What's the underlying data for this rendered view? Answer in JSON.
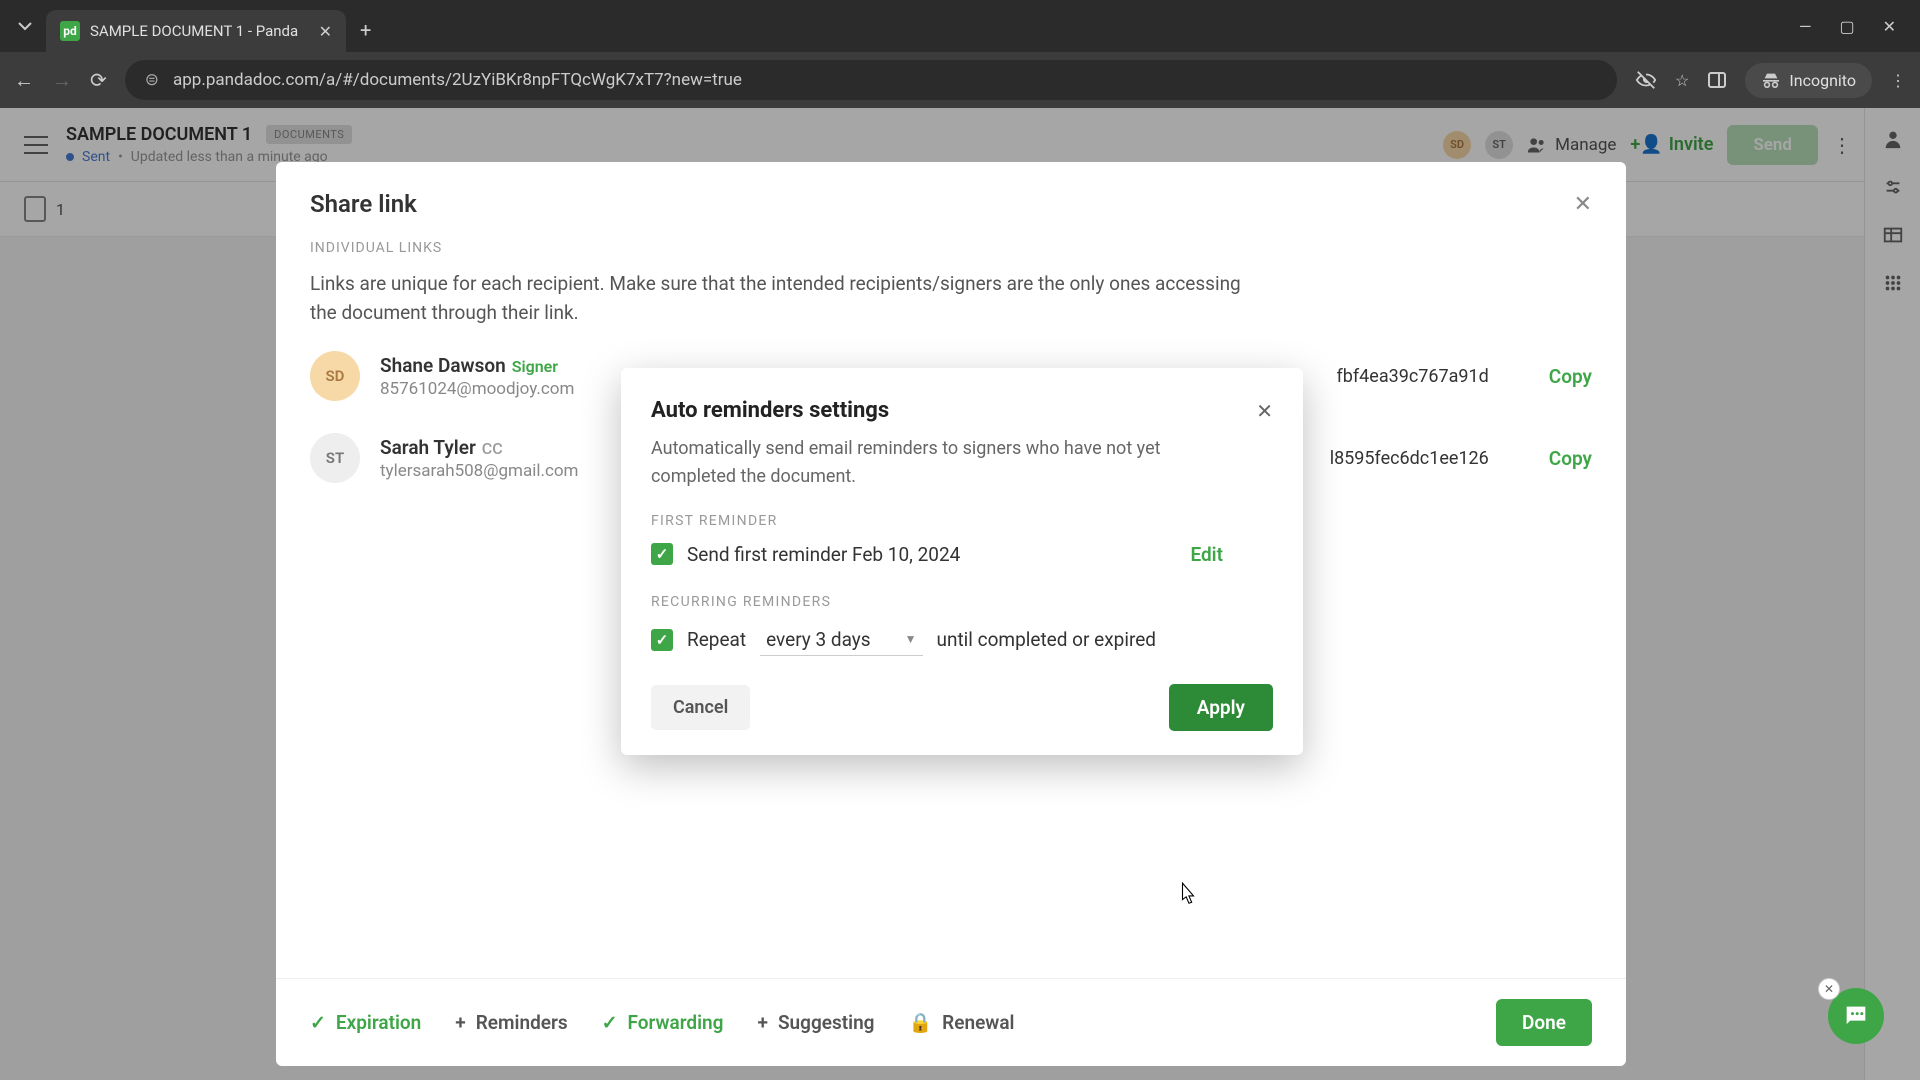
{
  "browser": {
    "tab_title": "SAMPLE DOCUMENT 1 - Panda",
    "url": "app.pandadoc.com/a/#/documents/2UzYiBKr8npFTQcWgK7xT7?new=true",
    "incognito": "Incognito"
  },
  "header": {
    "title": "SAMPLE DOCUMENT 1",
    "badge": "DOCUMENTS",
    "status": "Sent",
    "updated": "Updated less than a minute ago",
    "avatar1": "SD",
    "avatar2": "ST",
    "manage": "Manage",
    "invite": "Invite",
    "send": "Send",
    "help": "?"
  },
  "toolbar": {
    "doc_count": "1"
  },
  "share": {
    "title": "Share link",
    "section": "INDIVIDUAL LINKS",
    "desc": "Links are unique for each recipient. Make sure that the intended recipients/signers are the only ones accessing the document through their link.",
    "recipients": [
      {
        "initials": "SD",
        "name": "Shane Dawson",
        "role": "Signer",
        "email": "85761024@moodjoy.com",
        "link": "fbf4ea39c767a91d",
        "copy": "Copy"
      },
      {
        "initials": "ST",
        "name": "Sarah Tyler",
        "role": "CC",
        "email": "tylersarah508@gmail.com",
        "link": "l8595fec6dc1ee126",
        "copy": "Copy"
      }
    ],
    "footer": {
      "expiration": "Expiration",
      "reminders": "Reminders",
      "forwarding": "Forwarding",
      "suggesting": "Suggesting",
      "renewal": "Renewal",
      "done": "Done"
    }
  },
  "reminders": {
    "title": "Auto reminders settings",
    "desc": "Automatically send email reminders to signers who have not yet completed the document.",
    "first_label": "FIRST REMINDER",
    "first_text": "Send first reminder Feb 10, 2024",
    "edit": "Edit",
    "recurring_label": "RECURRING REMINDERS",
    "repeat": "Repeat",
    "frequency": "every 3 days",
    "until": "until completed or expired",
    "cancel": "Cancel",
    "apply": "Apply"
  }
}
